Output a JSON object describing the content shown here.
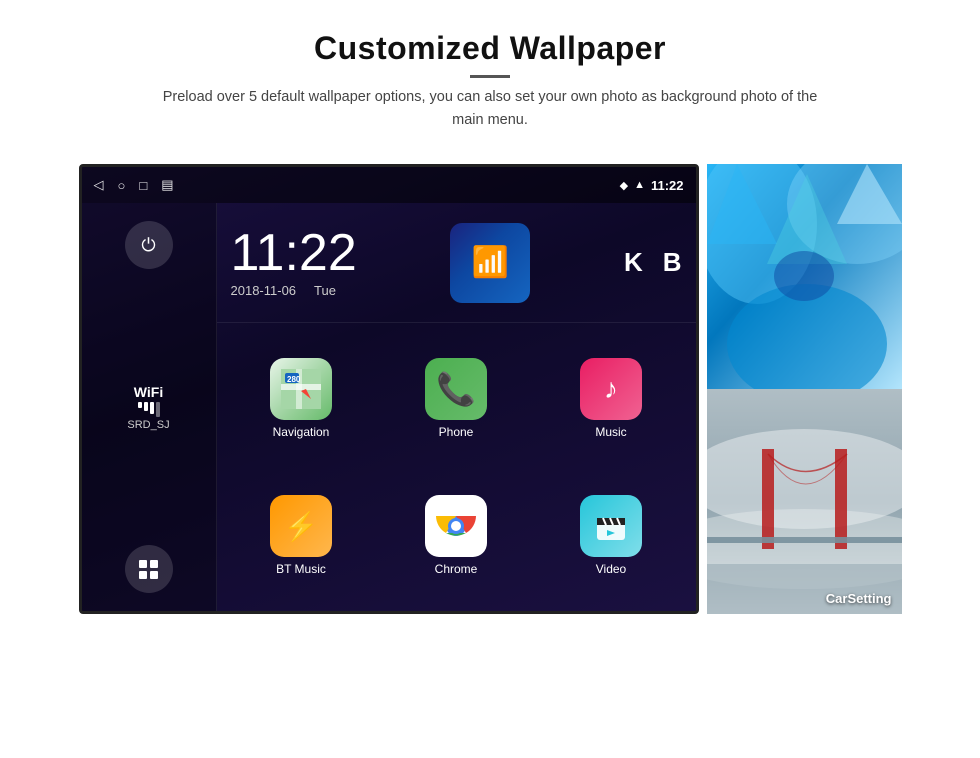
{
  "header": {
    "title": "Customized Wallpaper",
    "divider": true,
    "subtitle": "Preload over 5 default wallpaper options, you can also set your own photo as background photo of the main menu."
  },
  "statusBar": {
    "time": "11:22",
    "icons": [
      "◁",
      "○",
      "□",
      "▤"
    ],
    "rightIcons": [
      "♦",
      "▲"
    ]
  },
  "clock": {
    "time": "11:22",
    "date": "2018-11-06",
    "day": "Tue"
  },
  "wifi": {
    "label": "WiFi",
    "ssid": "SRD_SJ"
  },
  "apps": [
    {
      "label": "Navigation",
      "icon": "nav"
    },
    {
      "label": "Phone",
      "icon": "phone"
    },
    {
      "label": "Music",
      "icon": "music"
    },
    {
      "label": "BT Music",
      "icon": "bt"
    },
    {
      "label": "Chrome",
      "icon": "chrome"
    },
    {
      "label": "Video",
      "icon": "video"
    }
  ],
  "wallpapers": [
    {
      "label": ""
    },
    {
      "label": "CarSetting"
    }
  ]
}
